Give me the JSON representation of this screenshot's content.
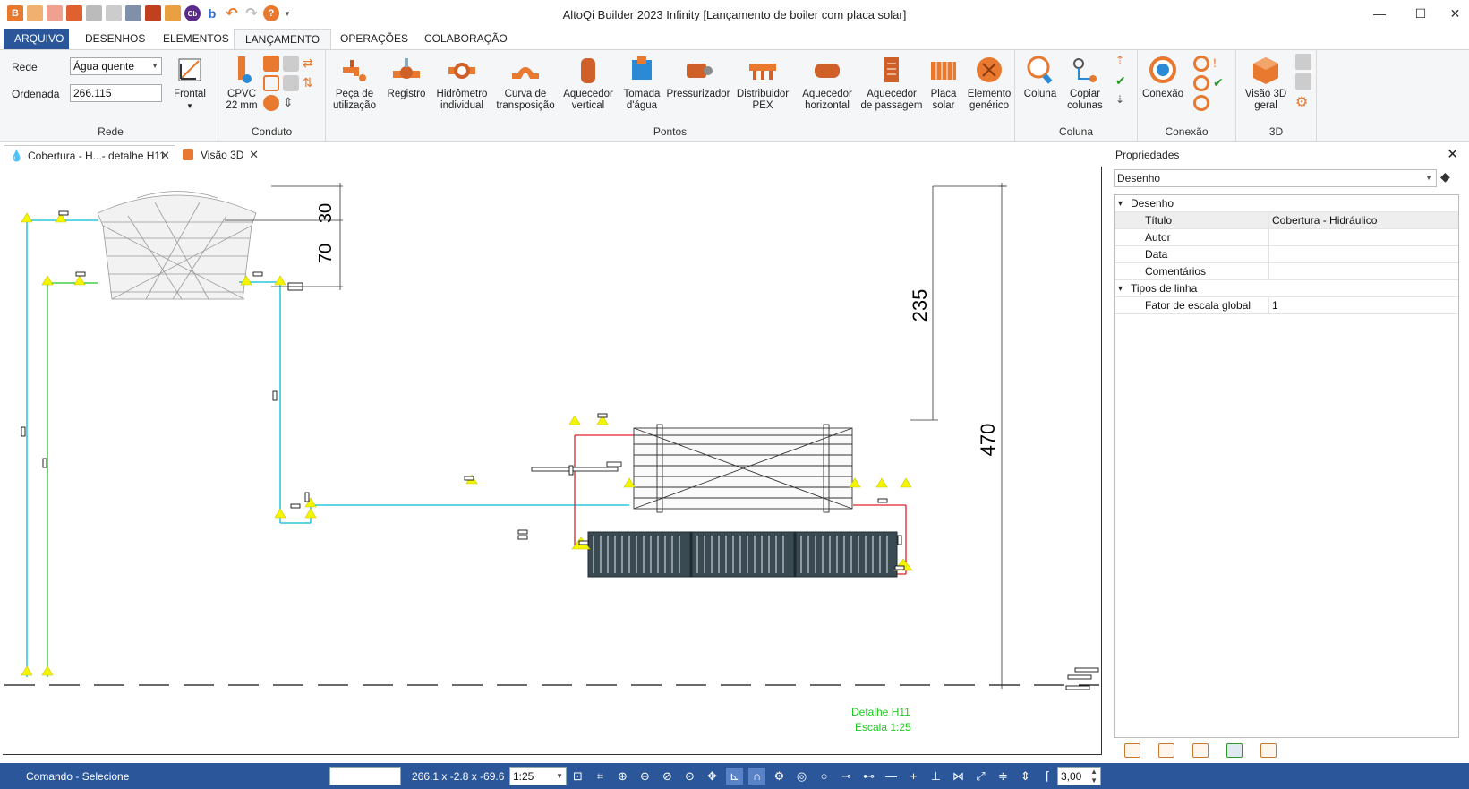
{
  "window": {
    "title": "AltoQi Builder 2023 Infinity [Lançamento de boiler com placa solar]"
  },
  "colors": {
    "accent": "#2b579a",
    "pipe_hot": "#e0202a",
    "pipe_cold": "#00bcd4",
    "pipe_green": "#22c322",
    "marker": "#f5f500",
    "icon_orange": "#e8792f",
    "detail_text": "#21c821"
  },
  "qat_icons": [
    "app-icon",
    "new-icon",
    "open-icon",
    "save-icon",
    "save-as-icon",
    "print-preview-icon",
    "print-icon",
    "cad-icon",
    "cb-icon",
    "b-icon",
    "undo-icon",
    "redo-icon",
    "help-icon",
    "customize-icon"
  ],
  "ribbon_tabs": [
    "ARQUIVO",
    "DESENHOS",
    "ELEMENTOS",
    "LANÇAMENTO",
    "OPERAÇÕES",
    "COLABORAÇÃO"
  ],
  "ribbon": {
    "rede": {
      "label": "Rede",
      "rede_label": "Rede",
      "rede_value": "Água quente",
      "ordenada_label": "Ordenada",
      "ordenada_value": "266.115",
      "view_label": "Frontal"
    },
    "conduto": {
      "label": "Conduto",
      "pipe_label": "CPVC",
      "pipe_size": "22 mm"
    },
    "pontos": {
      "label": "Pontos",
      "buttons": [
        {
          "l1": "Peça de",
          "l2": "utilização"
        },
        {
          "l1": "Registro",
          "l2": ""
        },
        {
          "l1": "Hidrômetro",
          "l2": "individual"
        },
        {
          "l1": "Curva de",
          "l2": "transposição"
        },
        {
          "l1": "Aquecedor",
          "l2": "vertical"
        },
        {
          "l1": "Tomada",
          "l2": "d'água"
        },
        {
          "l1": "Pressurizador",
          "l2": ""
        },
        {
          "l1": "Distribuidor",
          "l2": "PEX"
        },
        {
          "l1": "Aquecedor",
          "l2": "horizontal"
        },
        {
          "l1": "Aquecedor",
          "l2": "de passagem"
        },
        {
          "l1": "Placa",
          "l2": "solar"
        },
        {
          "l1": "Elemento",
          "l2": "genérico"
        }
      ]
    },
    "coluna": {
      "label": "Coluna",
      "b1": "Coluna",
      "b2a": "Copiar",
      "b2b": "colunas"
    },
    "conexao": {
      "label": "Conexão",
      "b1": "Conexão"
    },
    "tresd": {
      "label": "3D",
      "b1a": "Visão 3D",
      "b1b": "geral"
    }
  },
  "doc_tabs": [
    {
      "label": "Cobertura - H...- detalhe H11"
    },
    {
      "label": "Visão 3D"
    }
  ],
  "drawing": {
    "dimensions": [
      "30",
      "70",
      "235",
      "470"
    ],
    "detail_title": "Detalhe H11",
    "detail_scale": "Escala 1:25"
  },
  "properties": {
    "title": "Propriedades",
    "selector": "Desenho",
    "categories": [
      {
        "name": "Desenho",
        "rows": [
          {
            "key": "Título",
            "value": "Cobertura - Hidráulico"
          },
          {
            "key": "Autor",
            "value": ""
          },
          {
            "key": "Data",
            "value": ""
          },
          {
            "key": "Comentários",
            "value": ""
          }
        ]
      },
      {
        "name": "Tipos de linha",
        "rows": [
          {
            "key": "Fator de escala global",
            "value": "1"
          }
        ]
      }
    ]
  },
  "status": {
    "command": "Comando - Selecione",
    "coords": "266.1 x -2.8 x -69.6",
    "scale": "1:25",
    "value": "3,00"
  }
}
